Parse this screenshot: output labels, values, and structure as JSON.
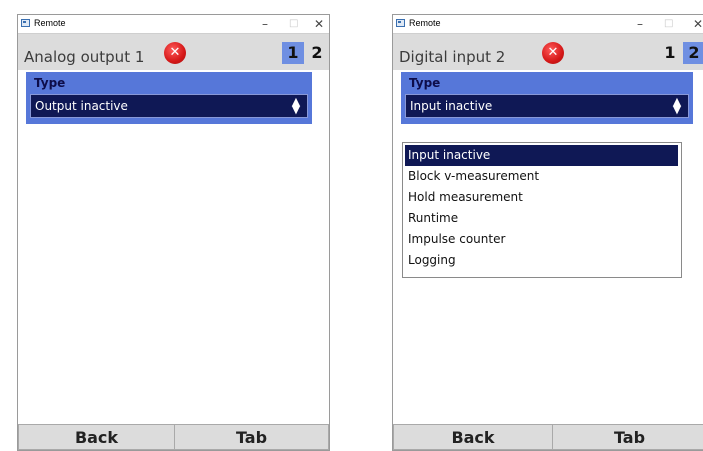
{
  "windows": [
    {
      "title": "Remote",
      "controls": {
        "minimize": "–",
        "maximize": "□",
        "close": "✕"
      },
      "page_title": "Analog output 1",
      "error_icon": "error-x-icon",
      "tabs": [
        "1",
        "2"
      ],
      "active_tab": "1",
      "field": {
        "label": "Type",
        "value": "Output inactive"
      },
      "buttons": {
        "back": "Back",
        "tab": "Tab"
      }
    },
    {
      "title": "Remote",
      "controls": {
        "minimize": "–",
        "maximize": "□",
        "close": "✕"
      },
      "page_title": "Digital input 2",
      "error_icon": "error-x-icon",
      "tabs": [
        "1",
        "2"
      ],
      "active_tab": "2",
      "field": {
        "label": "Type",
        "value": "Input inactive"
      },
      "dropdown_options": [
        "Input inactive",
        "Block v-measurement",
        "Hold measurement",
        "Runtime",
        "Impulse counter",
        "Logging"
      ],
      "selected_option": "Input inactive",
      "buttons": {
        "back": "Back",
        "tab": "Tab"
      }
    }
  ],
  "colors": {
    "accent": "#5677d9",
    "select_bg": "#0f1855",
    "tab_active": "#6f8fe2",
    "error": "#d51818",
    "chrome": "#dcdcdc"
  }
}
